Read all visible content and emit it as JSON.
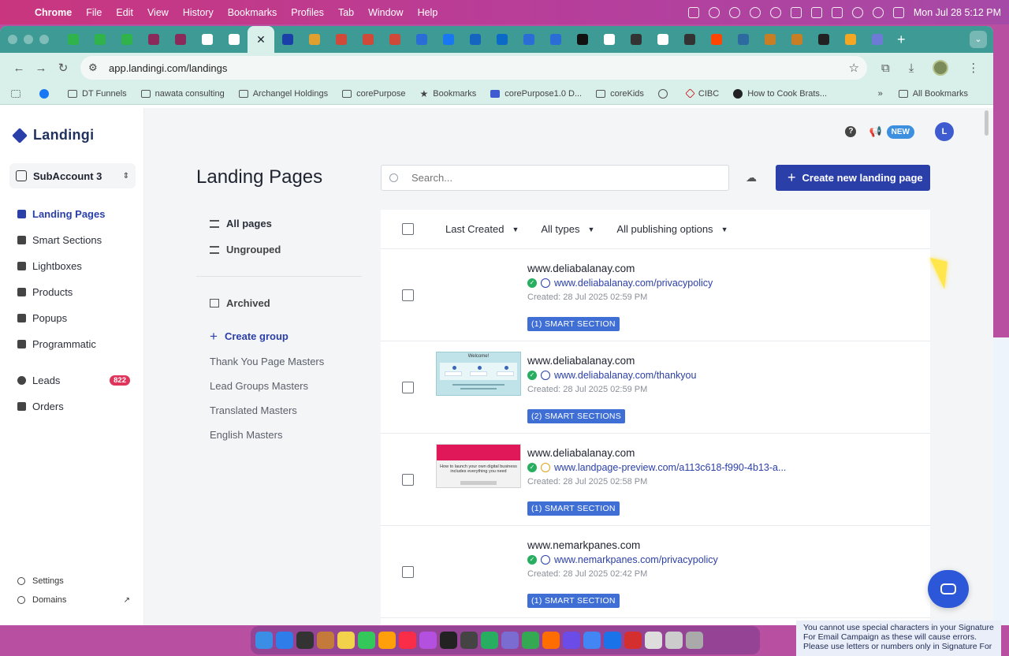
{
  "menubar": {
    "app": "Chrome",
    "items": [
      "File",
      "Edit",
      "View",
      "History",
      "Bookmarks",
      "Profiles",
      "Tab",
      "Window",
      "Help"
    ],
    "clock": "Mon Jul 28  5:12 PM"
  },
  "browser": {
    "url": "app.landingi.com/landings",
    "tab_colors": [
      "#2fb34a",
      "#2fb34a",
      "#2fb34a",
      "#8a2a5b",
      "#8a2a5b",
      "#ffffff",
      "#ffffff",
      "#d9efe9",
      "#1a3fa8",
      "#e0a030",
      "#d04a3a",
      "#d04a3a",
      "#d04a3a",
      "#2b6dd6",
      "#1877f2",
      "#1565c0",
      "#0b69c7",
      "#2b6dd6",
      "#2b6dd6",
      "#111111",
      "#ffffff",
      "#333333",
      "#ffffff",
      "#333333",
      "#ff4500",
      "#2d6a9f",
      "#c77e25",
      "#c77e25",
      "#222222",
      "#f5a623",
      "#6d7bd6"
    ],
    "bookmarks": [
      "DT Funnels",
      "nawata consulting",
      "Archangel Holdings",
      "corePurpose",
      "Bookmarks",
      "corePurpose1.0 D...",
      "coreKids",
      "CIBC",
      "How to Cook Brats..."
    ],
    "all_bookmarks": "All Bookmarks"
  },
  "sidebar": {
    "brand": "Landingi",
    "subaccount": "SubAccount 3",
    "nav": [
      {
        "label": "Landing Pages",
        "icon": "pages-icon",
        "active": true
      },
      {
        "label": "Smart Sections",
        "icon": "grid-icon"
      },
      {
        "label": "Lightboxes",
        "icon": "lightbox-icon"
      },
      {
        "label": "Products",
        "icon": "tag-icon"
      },
      {
        "label": "Popups",
        "icon": "popup-icon"
      },
      {
        "label": "Programmatic",
        "icon": "programmatic-icon"
      }
    ],
    "nav2": [
      {
        "label": "Leads",
        "icon": "user-icon",
        "badge": "822"
      },
      {
        "label": "Orders",
        "icon": "orders-icon"
      }
    ],
    "bottom": [
      {
        "label": "Settings",
        "icon": "gear-icon"
      },
      {
        "label": "Domains",
        "icon": "globe-icon"
      }
    ]
  },
  "header": {
    "new_badge": "NEW",
    "avatar_letter": "L"
  },
  "main": {
    "title": "Landing Pages",
    "search_placeholder": "Search...",
    "create_button": "Create new landing page",
    "groups": {
      "all_pages": "All pages",
      "ungrouped": "Ungrouped",
      "archived": "Archived",
      "create_group": "Create group",
      "masters": [
        "Thank You Page Masters",
        "Lead Groups Masters",
        "Translated Masters",
        "English Masters"
      ]
    },
    "filters": {
      "sort": "Last Created",
      "types": "All types",
      "publishing": "All publishing options"
    },
    "rows": [
      {
        "title": "www.deliabalanay.com",
        "url": "www.deliabalanay.com/privacypolicy",
        "created": "Created: 28 Jul 2025 02:59 PM",
        "tag": "(1) SMART SECTION",
        "thumb": "none"
      },
      {
        "title": "www.deliabalanay.com",
        "url": "www.deliabalanay.com/thankyou",
        "created": "Created: 28 Jul 2025 02:59 PM",
        "tag": "(2) SMART SECTIONS",
        "thumb": "welcome",
        "thumb_title": "Welcome!"
      },
      {
        "title": "www.deliabalanay.com",
        "url": "www.landpage-preview.com/a113c618-f990-4b13-a...",
        "created": "Created: 28 Jul 2025 02:58 PM",
        "tag": "(1) SMART SECTION",
        "thumb": "pink",
        "thumb_title": "How to launch your own digital business includes everything you need"
      },
      {
        "title": "www.nemarkpanes.com",
        "url": "www.nemarkpanes.com/privacypolicy",
        "created": "Created: 28 Jul 2025 02:42 PM",
        "tag": "(1) SMART SECTION",
        "thumb": "none"
      }
    ]
  },
  "notice": {
    "line1": "You cannot use special characters in your Signature",
    "line2": "For Email Campaign as these will cause errors.",
    "line3": "Please use letters or numbers only in Signature For"
  },
  "dock_colors": [
    "#3a8ee6",
    "#2e7de8",
    "#333",
    "#c47a3a",
    "#f2d24b",
    "#34c759",
    "#ff9f0a",
    "#fa2d48",
    "#b450e0",
    "#222",
    "#444",
    "#27ae60",
    "#7a6cd0",
    "#34a853",
    "#ff6d00",
    "#6b4ce6",
    "#4285f4",
    "#1a73e8",
    "#d32f2f",
    "#ddd",
    "#ccc",
    "#aaa"
  ]
}
